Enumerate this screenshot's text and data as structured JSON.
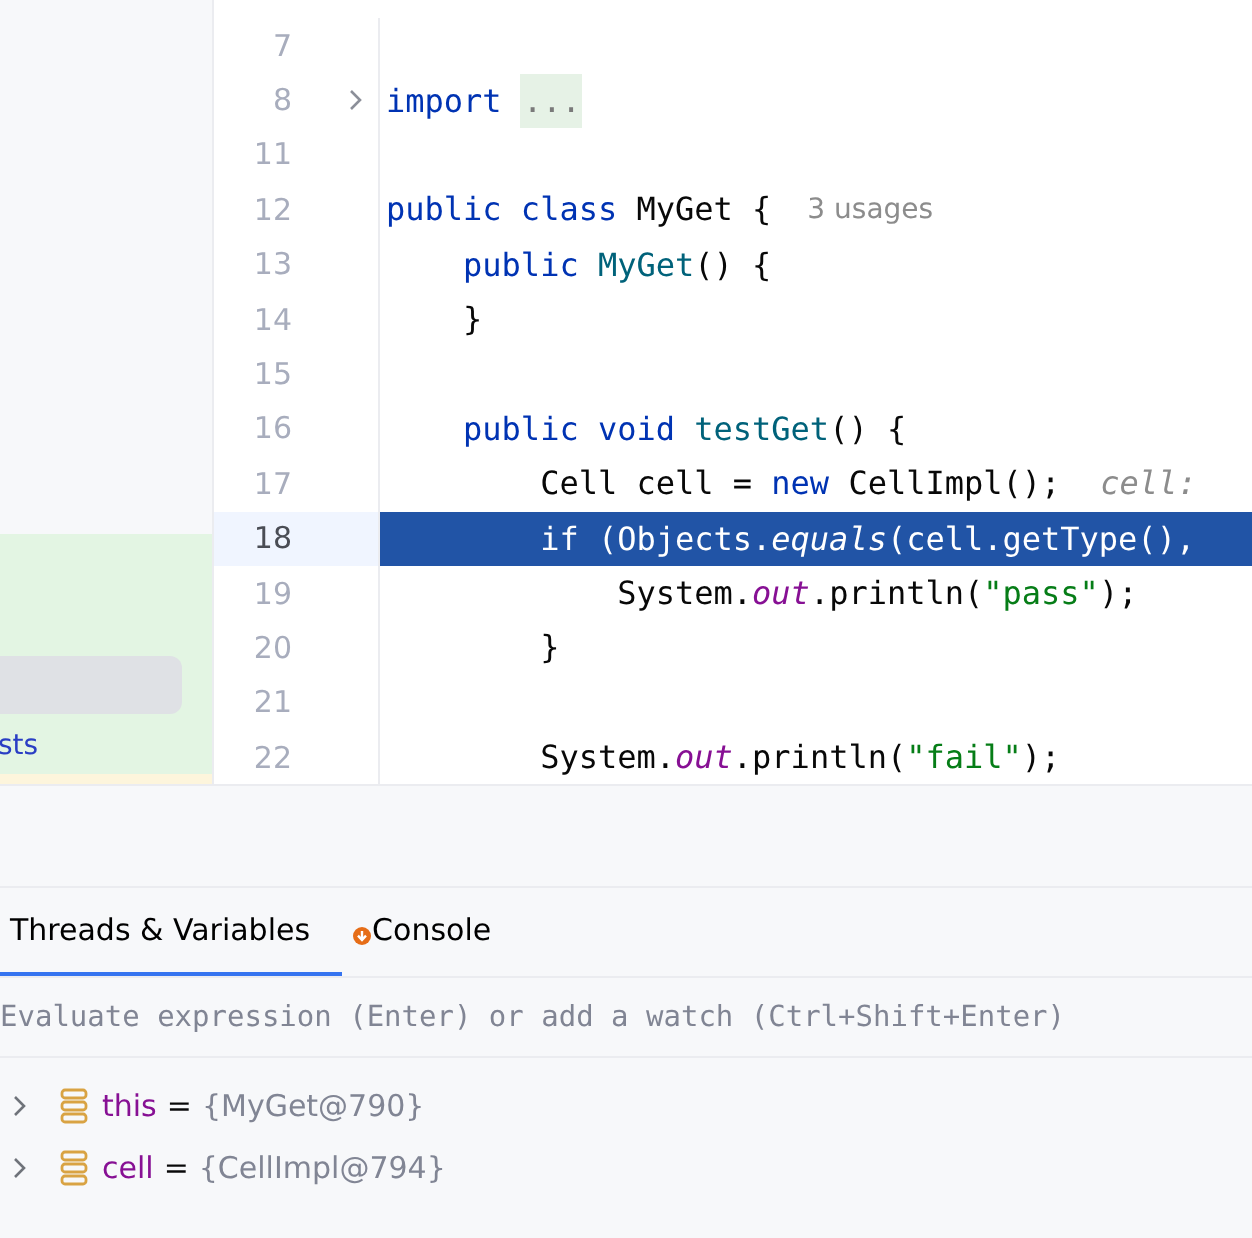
{
  "side_panel": {
    "cut_text": "sts"
  },
  "editor": {
    "lines": [
      {
        "number": "7",
        "current": false,
        "fold": false
      },
      {
        "number": "8",
        "current": false,
        "fold": true,
        "tokens": [
          {
            "kind": "keyword",
            "text": "import "
          },
          {
            "kind": "folded",
            "text": "..."
          }
        ]
      },
      {
        "number": "11",
        "current": false,
        "fold": false
      },
      {
        "number": "12",
        "current": false,
        "fold": false,
        "tokens": [
          {
            "kind": "keyword",
            "text": "public class "
          },
          {
            "kind": "plain",
            "text": "MyGet {"
          },
          {
            "kind": "hint",
            "text": "3 usages"
          }
        ]
      },
      {
        "number": "13",
        "current": false,
        "fold": false,
        "tokens": [
          {
            "kind": "keyword",
            "text": "    public "
          },
          {
            "kind": "declaration",
            "text": "MyGet"
          },
          {
            "kind": "plain",
            "text": "() {"
          }
        ]
      },
      {
        "number": "14",
        "current": false,
        "fold": false,
        "tokens": [
          {
            "kind": "plain",
            "text": "    }"
          }
        ]
      },
      {
        "number": "15",
        "current": false,
        "fold": false
      },
      {
        "number": "16",
        "current": false,
        "fold": false,
        "tokens": [
          {
            "kind": "keyword",
            "text": "    public void "
          },
          {
            "kind": "declaration",
            "text": "testGet"
          },
          {
            "kind": "plain",
            "text": "() {"
          }
        ]
      },
      {
        "number": "17",
        "current": false,
        "fold": false,
        "tokens": [
          {
            "kind": "plain",
            "text": "        Cell cell = "
          },
          {
            "kind": "keyword",
            "text": "new "
          },
          {
            "kind": "plain",
            "text": "CellImpl();"
          },
          {
            "kind": "inline_value",
            "text": "cell:"
          }
        ]
      },
      {
        "number": "18",
        "current": true,
        "fold": false,
        "tokens": [
          {
            "kind": "plain",
            "text": "        if (Objects."
          },
          {
            "kind": "static_call",
            "text": "equals"
          },
          {
            "kind": "plain",
            "text": "(cell.getType(),"
          }
        ]
      },
      {
        "number": "19",
        "current": false,
        "fold": false,
        "tokens": [
          {
            "kind": "plain",
            "text": "            System."
          },
          {
            "kind": "static_field",
            "text": "out"
          },
          {
            "kind": "plain",
            "text": ".println("
          },
          {
            "kind": "string",
            "text": "\"pass\""
          },
          {
            "kind": "plain",
            "text": ");"
          }
        ]
      },
      {
        "number": "20",
        "current": false,
        "fold": false,
        "tokens": [
          {
            "kind": "plain",
            "text": "        }"
          }
        ]
      },
      {
        "number": "21",
        "current": false,
        "fold": false
      },
      {
        "number": "22",
        "current": false,
        "fold": false,
        "tokens": [
          {
            "kind": "plain",
            "text": "        System."
          },
          {
            "kind": "static_field",
            "text": "out"
          },
          {
            "kind": "plain",
            "text": ".println("
          },
          {
            "kind": "string",
            "text": "\"fail\""
          },
          {
            "kind": "plain",
            "text": ");"
          }
        ]
      }
    ]
  },
  "debug_panel": {
    "tabs": [
      {
        "label": "Threads & Variables",
        "selected": true,
        "badge": false
      },
      {
        "label": "Console",
        "selected": false,
        "badge": true
      }
    ],
    "evaluate": {
      "placeholder": "Evaluate expression (Enter) or add a watch (Ctrl+Shift+Enter)"
    },
    "variables": [
      {
        "name": "this",
        "equals": "=",
        "value": "{MyGet@790}",
        "expanded": false
      },
      {
        "name": "cell",
        "equals": "=",
        "value": "{CellImpl@794}",
        "expanded": false
      }
    ]
  }
}
